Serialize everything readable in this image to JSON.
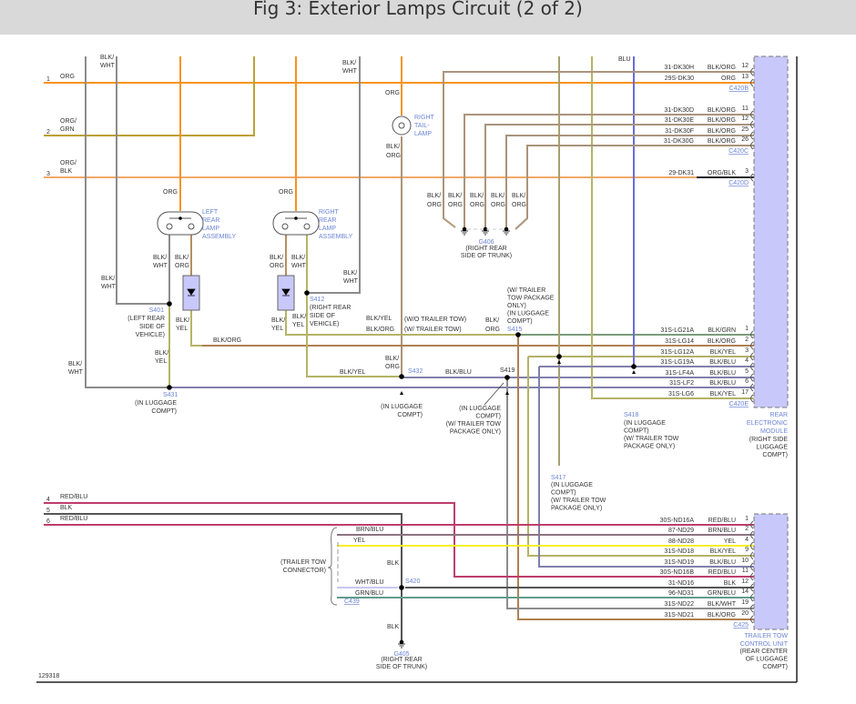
{
  "title": "Fig 3: Exterior Lamps Circuit (2 of 2)",
  "figure_id": "129318",
  "left_circuits": [
    {
      "pin": "1",
      "color": [
        "ORG"
      ]
    },
    {
      "pin": "2",
      "color": [
        "ORG/",
        "GRN"
      ]
    },
    {
      "pin": "3",
      "color": [
        "ORG/",
        "BLK"
      ]
    },
    {
      "pin": "4",
      "color": [
        "RED/BLU"
      ]
    },
    {
      "pin": "5",
      "color": [
        "BLK"
      ]
    },
    {
      "pin": "6",
      "color": [
        "RED/BLU"
      ]
    }
  ],
  "wire_labels": [
    "BLK/",
    "WHT",
    "BLK/",
    "WHT",
    "ORG",
    "BLK/",
    "ORG",
    "ORG",
    "ORG",
    "BLK/",
    "WHT",
    "BLK/",
    "ORG",
    "BLK/",
    "ORG",
    "BLK/",
    "WHT",
    "BLK/",
    "WHT",
    "BLK/",
    "WHT",
    "BLK/",
    "YEL",
    "BLK/",
    "YEL",
    "BLK/",
    "YEL",
    "BLK/ORG",
    "BLK/YEL",
    "BLK/ORG",
    "BLK/",
    "YEL",
    "BLK/",
    "WHT",
    "BLK/",
    "ORG",
    "BLK/YEL",
    "BLK/BLU",
    "BLK/",
    "ORG",
    "BLU",
    "BRN/BLU",
    "YEL",
    "BLK",
    "WHT/BLU",
    "GRN/BLU",
    "BLK"
  ],
  "g406_wire_label": [
    "BLK/",
    "ORG"
  ],
  "components": {
    "right_tail_lamp": [
      "RIGHT",
      "TAIL-",
      "LAMP"
    ],
    "left_rear_lamp": [
      "LEFT",
      "REAR",
      "LAMP",
      "ASSEMBLY"
    ],
    "right_rear_lamp": [
      "RIGHT",
      "REAR",
      "LAMP",
      "ASSEMBLY"
    ],
    "rem": [
      "REAR",
      "ELECTRONIC",
      "MODULE"
    ],
    "rem_loc": [
      "(RIGHT SIDE",
      "LUGGAGE",
      "COMPT)"
    ],
    "ttcu": [
      "TRAILER TOW",
      "CONTROL UNIT"
    ],
    "ttcu_loc": [
      "(REAR CENTER",
      "OF LUGGAGE",
      "COMPT)"
    ],
    "trailer_connector": [
      "(TRAILER TOW",
      "CONNECTOR)"
    ],
    "c439": "C439"
  },
  "splices": {
    "s401": {
      "id": "S401",
      "loc": [
        "(LEFT REAR",
        "SIDE OF",
        "VEHICLE)"
      ]
    },
    "s412": {
      "id": "S412",
      "loc": [
        "(RIGHT REAR",
        "SIDE OF",
        "VEHICLE)"
      ]
    },
    "s431": {
      "id": "S431",
      "loc": [
        "(IN LUGGAGE",
        "COMPT)"
      ]
    },
    "s432": {
      "id": "S432",
      "loc": [
        "(IN LUGGAGE",
        "COMPT)"
      ]
    },
    "s415": {
      "id": "S415",
      "loc": [
        "(W/ TRAILER",
        "TOW PACKAGE",
        "ONLY)",
        "(IN LUGGAGE",
        "COMPT)"
      ]
    },
    "s419": {
      "id": "S419",
      "loc": [
        "(IN LUGGAGE",
        "COMPT)",
        "(W/ TRAILER TOW",
        "PACKAGE ONLY)"
      ]
    },
    "s418": {
      "id": "S418",
      "loc": [
        "(IN LUGGAGE",
        "COMPT)",
        "(W/ TRAILER TOW",
        "PACKAGE ONLY)"
      ]
    },
    "s417": {
      "id": "S417",
      "loc": [
        "(IN LUGGAGE",
        "COMPT)",
        "(W/ TRAILER TOW",
        "PACKAGE ONLY)"
      ]
    },
    "s420": {
      "id": "S420"
    },
    "g406": {
      "id": "G406",
      "loc": [
        "(RIGHT REAR",
        "SIDE OF TRUNK)"
      ]
    },
    "g405": {
      "id": "G405",
      "loc": [
        "(RIGHT REAR",
        "SIDE OF TRUNK)"
      ]
    }
  },
  "trailer_tow_notes": [
    "(W/O TRAILER TOW)",
    "(W/ TRAILER TOW)"
  ],
  "rem_pins": [
    {
      "circuit": "31-DK30H",
      "color": "BLK/ORG",
      "pin": "12"
    },
    {
      "circuit": "29S-DK30",
      "color": "ORG",
      "pin": "13",
      "connector": "C420B"
    },
    {
      "circuit": "31-DK30D",
      "color": "BLK/ORG",
      "pin": "11"
    },
    {
      "circuit": "31-DK30E",
      "color": "BLK/ORG",
      "pin": "12"
    },
    {
      "circuit": "31-DK30F",
      "color": "BLK/ORG",
      "pin": "25"
    },
    {
      "circuit": "31-DK30G",
      "color": "BLK/ORG",
      "pin": "26",
      "connector": "C420C"
    },
    {
      "circuit": "29-DK31",
      "color": "ORG/BLK",
      "pin": "3",
      "connector": "C420D"
    },
    {
      "circuit": "31S-LG21A",
      "color": "BLK/GRN",
      "pin": "1"
    },
    {
      "circuit": "31S-LG14",
      "color": "BLK/ORG",
      "pin": "2"
    },
    {
      "circuit": "31S-LG12A",
      "color": "BLK/YEL",
      "pin": "3"
    },
    {
      "circuit": "31S-LG19A",
      "color": "BLK/BLU",
      "pin": "4"
    },
    {
      "circuit": "31S-LF4A",
      "color": "BLK/BLU",
      "pin": "5"
    },
    {
      "circuit": "31S-LF2",
      "color": "BLK/BLU",
      "pin": "6"
    },
    {
      "circuit": "31S-LG6",
      "color": "BLK/YEL",
      "pin": "17",
      "connector": "C420E"
    }
  ],
  "ttcu_pins": [
    {
      "circuit": "30S-ND16A",
      "color": "RED/BLU",
      "pin": "1"
    },
    {
      "circuit": "87-ND29",
      "color": "BRN/BLU",
      "pin": "2"
    },
    {
      "circuit": "88-ND28",
      "color": "YEL",
      "pin": "4"
    },
    {
      "circuit": "31S-ND18",
      "color": "BLK/YEL",
      "pin": "9"
    },
    {
      "circuit": "31S-ND19",
      "color": "BLK/BLU",
      "pin": "10"
    },
    {
      "circuit": "30S-ND16B",
      "color": "RED/BLU",
      "pin": "11"
    },
    {
      "circuit": "31-ND16",
      "color": "BLK",
      "pin": "12"
    },
    {
      "circuit": "96-ND31",
      "color": "GRN/BLU",
      "pin": "14"
    },
    {
      "circuit": "31S-ND22",
      "color": "BLK/WHT",
      "pin": "19"
    },
    {
      "circuit": "31S-ND21",
      "color": "BLK/ORG",
      "pin": "20",
      "connector": "C425"
    }
  ],
  "colors": {
    "module_fill": "#c8c8fa",
    "org": "#f7931e",
    "blk": "#8c8c8c",
    "blu": "#6b6bdc",
    "yel": "#f5ef2a",
    "red": "#f0222a",
    "grn": "#5cb85c"
  }
}
